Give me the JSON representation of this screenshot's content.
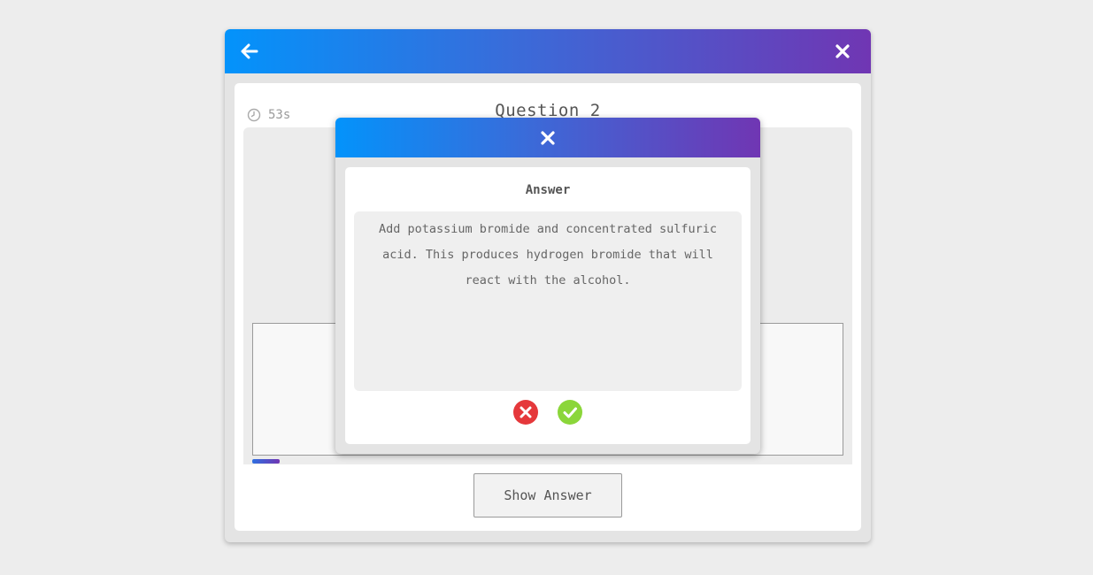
{
  "window": {
    "back_icon": "arrow-left-icon",
    "close_icon": "close-icon"
  },
  "quiz": {
    "timer": "53s",
    "timer_icon": "clock-icon",
    "question_title": "Question 2",
    "progress_fraction": 0.045,
    "show_answer_label": "Show Answer"
  },
  "modal": {
    "close_icon": "close-icon",
    "title": "Answer",
    "answer_text": "Add potassium bromide and concentrated sulfuric acid. This produces hydrogen bromide that will react with the alcohol.",
    "wrong_icon": "x-circle-icon",
    "correct_icon": "check-circle-icon"
  },
  "colors": {
    "header_gradient_start": "#0393fb",
    "header_gradient_end": "#7036b3",
    "wrong": "#e5383b",
    "correct": "#8bd63a"
  }
}
